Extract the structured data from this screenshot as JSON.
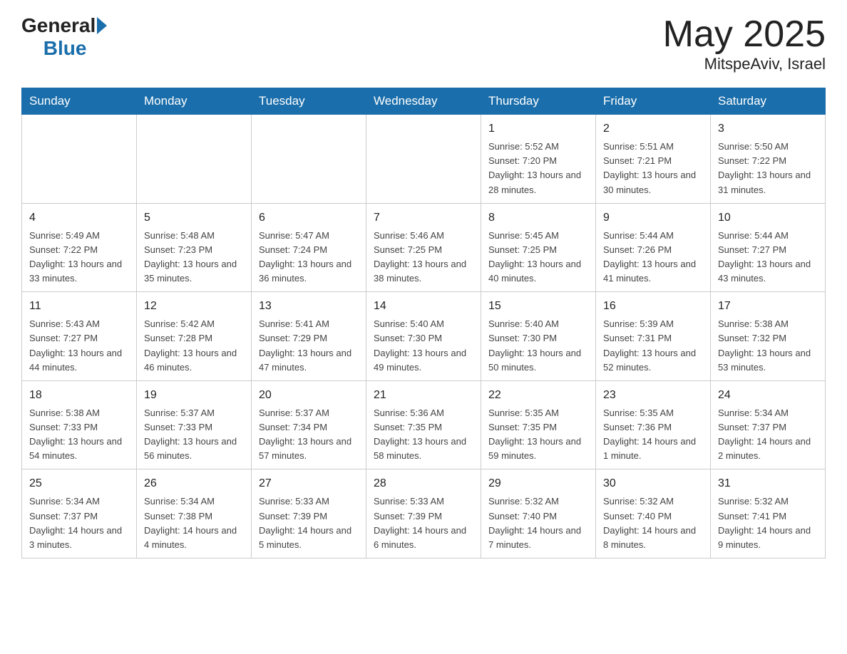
{
  "header": {
    "logo_general": "General",
    "logo_blue": "Blue",
    "month_title": "May 2025",
    "location": "MitspeAviv, Israel"
  },
  "days_of_week": [
    "Sunday",
    "Monday",
    "Tuesday",
    "Wednesday",
    "Thursday",
    "Friday",
    "Saturday"
  ],
  "weeks": [
    [
      {
        "day": "",
        "info": ""
      },
      {
        "day": "",
        "info": ""
      },
      {
        "day": "",
        "info": ""
      },
      {
        "day": "",
        "info": ""
      },
      {
        "day": "1",
        "info": "Sunrise: 5:52 AM\nSunset: 7:20 PM\nDaylight: 13 hours and 28 minutes."
      },
      {
        "day": "2",
        "info": "Sunrise: 5:51 AM\nSunset: 7:21 PM\nDaylight: 13 hours and 30 minutes."
      },
      {
        "day": "3",
        "info": "Sunrise: 5:50 AM\nSunset: 7:22 PM\nDaylight: 13 hours and 31 minutes."
      }
    ],
    [
      {
        "day": "4",
        "info": "Sunrise: 5:49 AM\nSunset: 7:22 PM\nDaylight: 13 hours and 33 minutes."
      },
      {
        "day": "5",
        "info": "Sunrise: 5:48 AM\nSunset: 7:23 PM\nDaylight: 13 hours and 35 minutes."
      },
      {
        "day": "6",
        "info": "Sunrise: 5:47 AM\nSunset: 7:24 PM\nDaylight: 13 hours and 36 minutes."
      },
      {
        "day": "7",
        "info": "Sunrise: 5:46 AM\nSunset: 7:25 PM\nDaylight: 13 hours and 38 minutes."
      },
      {
        "day": "8",
        "info": "Sunrise: 5:45 AM\nSunset: 7:25 PM\nDaylight: 13 hours and 40 minutes."
      },
      {
        "day": "9",
        "info": "Sunrise: 5:44 AM\nSunset: 7:26 PM\nDaylight: 13 hours and 41 minutes."
      },
      {
        "day": "10",
        "info": "Sunrise: 5:44 AM\nSunset: 7:27 PM\nDaylight: 13 hours and 43 minutes."
      }
    ],
    [
      {
        "day": "11",
        "info": "Sunrise: 5:43 AM\nSunset: 7:27 PM\nDaylight: 13 hours and 44 minutes."
      },
      {
        "day": "12",
        "info": "Sunrise: 5:42 AM\nSunset: 7:28 PM\nDaylight: 13 hours and 46 minutes."
      },
      {
        "day": "13",
        "info": "Sunrise: 5:41 AM\nSunset: 7:29 PM\nDaylight: 13 hours and 47 minutes."
      },
      {
        "day": "14",
        "info": "Sunrise: 5:40 AM\nSunset: 7:30 PM\nDaylight: 13 hours and 49 minutes."
      },
      {
        "day": "15",
        "info": "Sunrise: 5:40 AM\nSunset: 7:30 PM\nDaylight: 13 hours and 50 minutes."
      },
      {
        "day": "16",
        "info": "Sunrise: 5:39 AM\nSunset: 7:31 PM\nDaylight: 13 hours and 52 minutes."
      },
      {
        "day": "17",
        "info": "Sunrise: 5:38 AM\nSunset: 7:32 PM\nDaylight: 13 hours and 53 minutes."
      }
    ],
    [
      {
        "day": "18",
        "info": "Sunrise: 5:38 AM\nSunset: 7:33 PM\nDaylight: 13 hours and 54 minutes."
      },
      {
        "day": "19",
        "info": "Sunrise: 5:37 AM\nSunset: 7:33 PM\nDaylight: 13 hours and 56 minutes."
      },
      {
        "day": "20",
        "info": "Sunrise: 5:37 AM\nSunset: 7:34 PM\nDaylight: 13 hours and 57 minutes."
      },
      {
        "day": "21",
        "info": "Sunrise: 5:36 AM\nSunset: 7:35 PM\nDaylight: 13 hours and 58 minutes."
      },
      {
        "day": "22",
        "info": "Sunrise: 5:35 AM\nSunset: 7:35 PM\nDaylight: 13 hours and 59 minutes."
      },
      {
        "day": "23",
        "info": "Sunrise: 5:35 AM\nSunset: 7:36 PM\nDaylight: 14 hours and 1 minute."
      },
      {
        "day": "24",
        "info": "Sunrise: 5:34 AM\nSunset: 7:37 PM\nDaylight: 14 hours and 2 minutes."
      }
    ],
    [
      {
        "day": "25",
        "info": "Sunrise: 5:34 AM\nSunset: 7:37 PM\nDaylight: 14 hours and 3 minutes."
      },
      {
        "day": "26",
        "info": "Sunrise: 5:34 AM\nSunset: 7:38 PM\nDaylight: 14 hours and 4 minutes."
      },
      {
        "day": "27",
        "info": "Sunrise: 5:33 AM\nSunset: 7:39 PM\nDaylight: 14 hours and 5 minutes."
      },
      {
        "day": "28",
        "info": "Sunrise: 5:33 AM\nSunset: 7:39 PM\nDaylight: 14 hours and 6 minutes."
      },
      {
        "day": "29",
        "info": "Sunrise: 5:32 AM\nSunset: 7:40 PM\nDaylight: 14 hours and 7 minutes."
      },
      {
        "day": "30",
        "info": "Sunrise: 5:32 AM\nSunset: 7:40 PM\nDaylight: 14 hours and 8 minutes."
      },
      {
        "day": "31",
        "info": "Sunrise: 5:32 AM\nSunset: 7:41 PM\nDaylight: 14 hours and 9 minutes."
      }
    ]
  ]
}
